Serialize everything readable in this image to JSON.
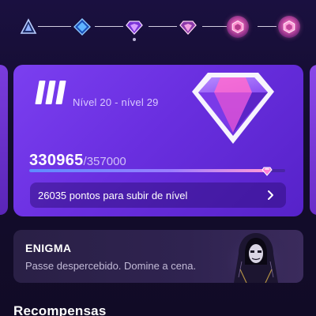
{
  "stepper": {
    "tiers": [
      {
        "name": "tier-1-triangle-icon",
        "color": "#a9c2ff"
      },
      {
        "name": "tier-2-diamond-icon",
        "color": "#4aa3ff"
      },
      {
        "name": "tier-3-gem-icon",
        "color": "#c97cff"
      },
      {
        "name": "tier-4-gem-icon",
        "color": "#e28bd8"
      },
      {
        "name": "tier-5-emblem-icon",
        "color": "#ff8fc8"
      },
      {
        "name": "tier-6-emblem-icon",
        "color": "#ff8fc8"
      }
    ],
    "current_index": 2
  },
  "level_card": {
    "roman_numeral": "III",
    "level_range": "Nível 20 - nível 29",
    "points_current": "330965",
    "points_separator": "/",
    "points_total": "357000",
    "progress_fraction": 0.927,
    "next_level_text": "26035 pontos para subir de nível",
    "gem_icon": "diamond-gem-icon",
    "accent": "#7b3ff0"
  },
  "title_card": {
    "name": "ENIGMA",
    "description": "Passe despercebido. Domine a cena.",
    "image": "hooded-figure-illustration"
  },
  "rewards": {
    "heading": "Recompensas"
  }
}
